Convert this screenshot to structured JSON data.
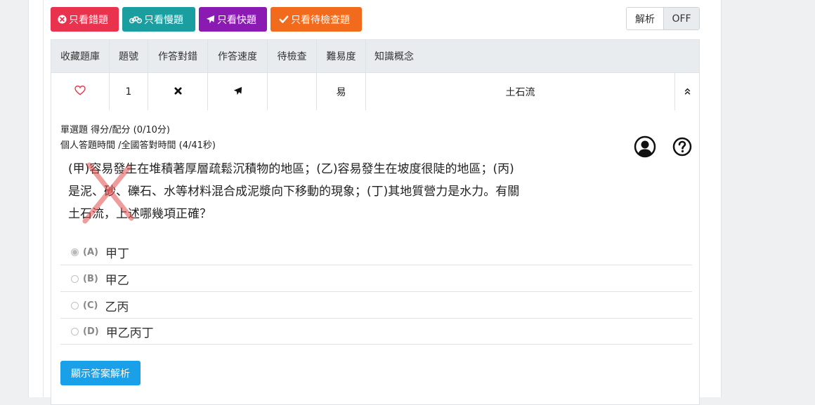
{
  "filters": {
    "wrong_icon": "times-circle-icon",
    "wrong_label": "只看錯題",
    "slow_icon": "bicycle-icon",
    "slow_label": "只看慢題",
    "fast_icon": "plane-icon",
    "fast_label": "只看快題",
    "check_icon": "check-icon",
    "check_label": "只看待檢查題"
  },
  "toggle": {
    "label": "解析",
    "state": "OFF"
  },
  "table": {
    "headers": [
      "收藏題庫",
      "題號",
      "作答對錯",
      "作答速度",
      "待檢查",
      "難易度",
      "知識概念"
    ],
    "row": {
      "favorite_icon": "heart-icon",
      "number": "1",
      "correctness_icon": "times-icon",
      "speed_icon": "plane-icon",
      "pending": "",
      "difficulty": "易",
      "concept": "土石流",
      "expand_icon": "chevron-double-up-icon"
    }
  },
  "question": {
    "type_score": "單選題 得分/配分 (0/10分)",
    "time_info": "個人答題時間 /全國答對時間 (4/41秒)",
    "lines": [
      "(甲)容易發生在堆積著厚層疏鬆沉積物的地區；(乙)容易發生在坡度很陡的地區；(丙)",
      "是泥、砂、礫石、水等材料混合成泥漿向下移動的現象；(丁)其地質營力是水力。有關",
      "土石流，上述哪幾項正確？"
    ],
    "options": [
      {
        "label": "(A)",
        "text": "甲丁",
        "selected": true
      },
      {
        "label": "(B)",
        "text": "甲乙",
        "selected": false
      },
      {
        "label": "(C)",
        "text": "乙丙",
        "selected": false
      },
      {
        "label": "(D)",
        "text": "甲乙丙丁",
        "selected": false
      }
    ],
    "show_answer_label": "顯示答案解析"
  },
  "colors": {
    "wrong": "#e9334e",
    "slow": "#1a9ea0",
    "fast": "#8a1ab2",
    "check": "#f26a1b",
    "primary": "#1aa0e8",
    "heart": "#e9334e",
    "wrong_mark": "#e24a4a"
  }
}
